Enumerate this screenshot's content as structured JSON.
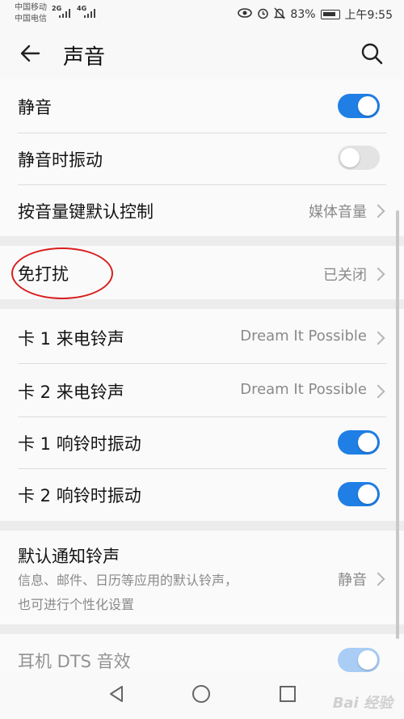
{
  "status_bar": {
    "carrier1": "中国移动",
    "carrier2": "中国电信",
    "net1": "2G",
    "net2": "4G",
    "battery": "83%",
    "time": "上午9:55"
  },
  "header": {
    "title": "声音"
  },
  "settings": {
    "mute": {
      "label": "静音",
      "toggle": true
    },
    "vibrate_on_mute": {
      "label": "静音时振动",
      "toggle": false
    },
    "volume_key_default": {
      "label": "按音量键默认控制",
      "value": "媒体音量"
    },
    "do_not_disturb": {
      "label": "免打扰",
      "value": "已关闭"
    },
    "sim1_ringtone": {
      "label": "卡 1 来电铃声",
      "value": "Dream It Possible"
    },
    "sim2_ringtone": {
      "label": "卡 2 来电铃声",
      "value": "Dream It Possible"
    },
    "sim1_vibrate": {
      "label": "卡 1 响铃时振动",
      "toggle": true
    },
    "sim2_vibrate": {
      "label": "卡 2 响铃时振动",
      "toggle": true
    },
    "default_notification": {
      "label": "默认通知铃声",
      "desc_line1": "信息、邮件、日历等应用的默认铃声，",
      "desc_line2": "也可进行个性化设置",
      "value": "静音"
    },
    "dts": {
      "label": "耳机 DTS 音效",
      "toggle": true,
      "disabled": true
    }
  },
  "watermark": "Bai 经验",
  "colors": {
    "toggle_on": "#1f7fe5",
    "annotation": "#d81f1f"
  }
}
